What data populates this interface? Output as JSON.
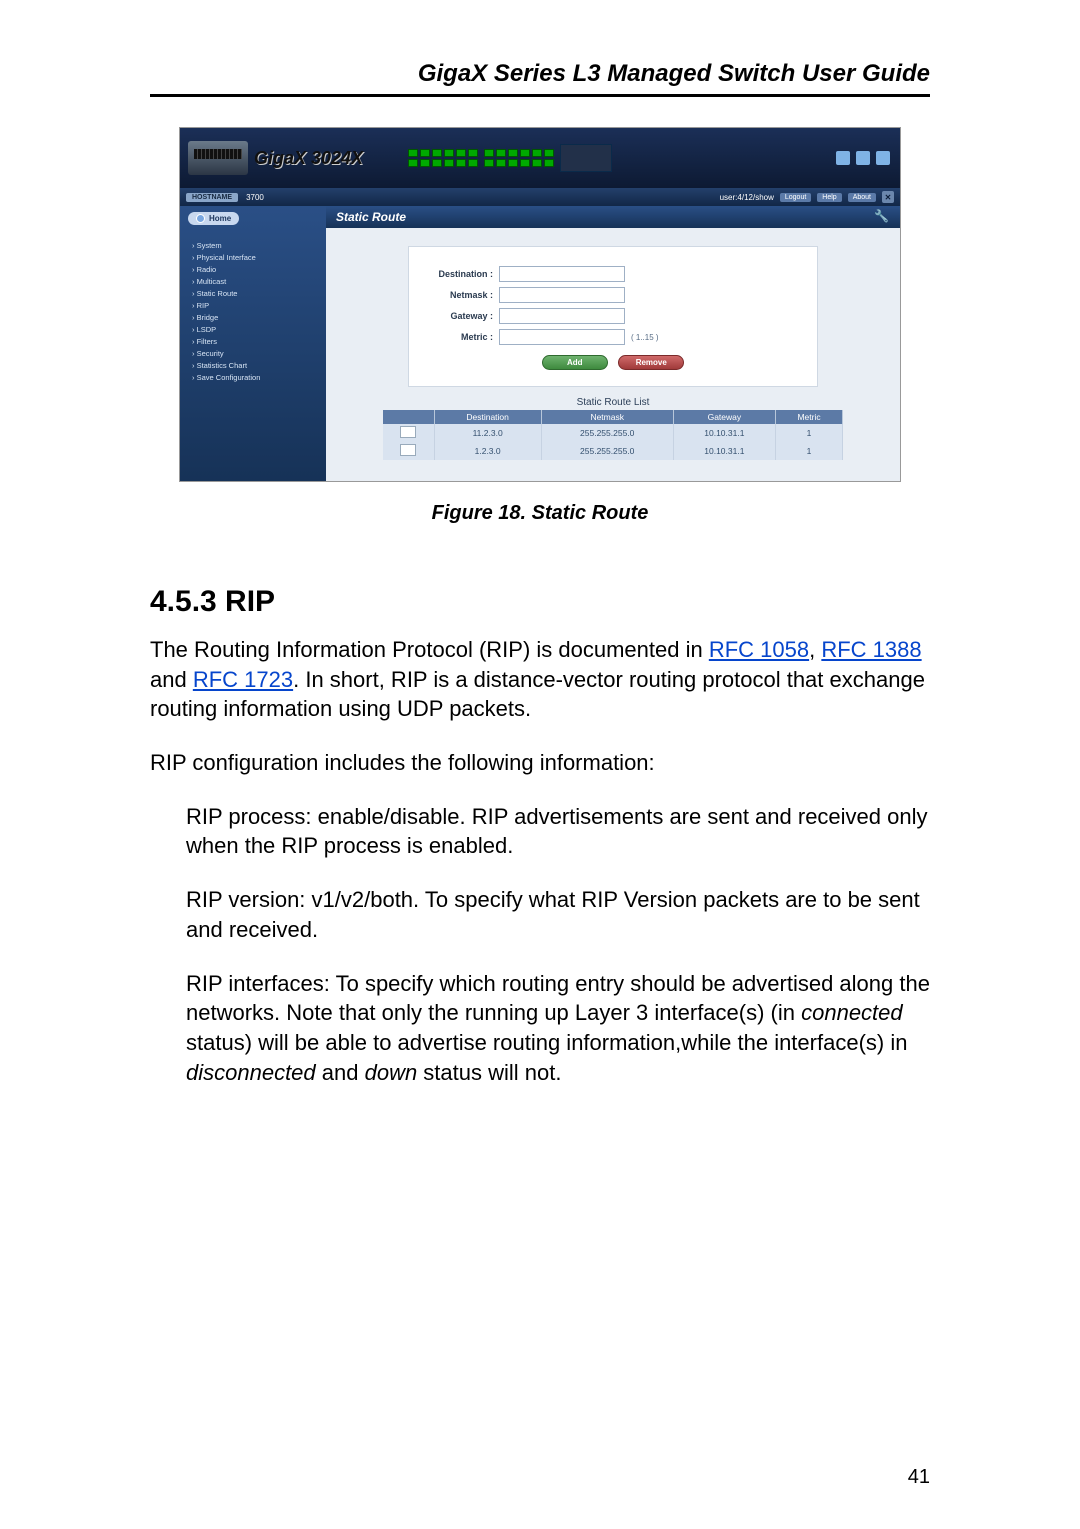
{
  "doc": {
    "header": "GigaX Series L3 Managed Switch User Guide",
    "page_number": "41"
  },
  "figure": {
    "caption": "Figure 18.  Static Route"
  },
  "ui": {
    "brand": "GigaX 3024X",
    "hostname_label": "HOSTNAME",
    "hostname": "3700",
    "user_info": "user:4/12/show",
    "top_links": [
      "Logout",
      "Help",
      "About"
    ],
    "home_pill": "Home",
    "nav_items": [
      "System",
      "Physical Interface",
      "Radio",
      "Multicast",
      "Static Route",
      "RIP",
      "Bridge",
      "LSDP",
      "Filters",
      "Security",
      "Statistics Chart",
      "Save Configuration"
    ],
    "panel_title": "Static Route",
    "form": {
      "destination_label": "Destination :",
      "netmask_label": "Netmask :",
      "gateway_label": "Gateway :",
      "metric_label": "Metric :",
      "metric_hint": "( 1..15 )",
      "add_btn": "Add",
      "remove_btn": "Remove"
    },
    "list_caption": "Static Route List",
    "table": {
      "headers": [
        "",
        "Destination",
        "Netmask",
        "Gateway",
        "Metric"
      ],
      "rows": [
        {
          "dest": "11.2.3.0",
          "mask": "255.255.255.0",
          "gw": "10.10.31.1",
          "metric": "1"
        },
        {
          "dest": "1.2.3.0",
          "mask": "255.255.255.0",
          "gw": "10.10.31.1",
          "metric": "1"
        }
      ]
    }
  },
  "section": {
    "number_title": "4.5.3  RIP",
    "p1_a": "The Routing Information Protocol (RIP) is documented in ",
    "rfc1": "RFC 1058",
    "p1_b": ", ",
    "rfc2": "RFC 1388",
    "p1_c": " and ",
    "rfc3": "RFC 1723",
    "p1_d": ". In short, RIP is a distance-vector routing protocol that exchange routing information using UDP packets.",
    "p2": "RIP configuration includes the following information:",
    "bp1": "RIP process: enable/disable. RIP advertisements are sent and received only when the RIP process is enabled.",
    "bp2": "RIP version: v1/v2/both. To specify what RIP Version packets are to be sent and received.",
    "bp3_a": "RIP interfaces: To specify which routing entry should be advertised along the networks. Note that only the running up Layer 3 interface(s) (in ",
    "bp3_em1": "connected",
    "bp3_b": " status) will be able to advertise routing information,while the interface(s) in ",
    "bp3_em2": "disconnected",
    "bp3_c": " and ",
    "bp3_em3": "down",
    "bp3_d": " status will not."
  }
}
